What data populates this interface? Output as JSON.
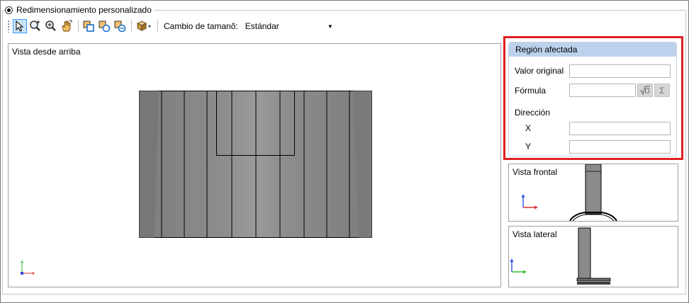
{
  "option": {
    "label": "Redimensionamiento personalizado",
    "selected": true
  },
  "toolbar": {
    "tools": [
      {
        "name": "select-pointer-icon",
        "active": true
      },
      {
        "name": "zoom-window-icon",
        "active": false
      },
      {
        "name": "zoom-icon",
        "active": false
      },
      {
        "name": "pan-hand-icon",
        "active": false
      },
      {
        "name": "region-select-icon",
        "active": false
      },
      {
        "name": "region-add-icon",
        "active": false
      },
      {
        "name": "region-subtract-icon",
        "active": false
      },
      {
        "name": "view-cube-icon",
        "active": false
      }
    ],
    "resize_label": "Cambio de tamanõ:",
    "resize_value": "Estándar"
  },
  "views": {
    "top": "Vista desde arriba",
    "front": "Vista frontal",
    "side": "Vista lateral"
  },
  "region": {
    "title": "Región afectada",
    "original_value_label": "Valor original",
    "original_value": "",
    "formula_label": "Fórmula",
    "formula_value": "",
    "formula_button_icon": "sqrt-formula-icon",
    "sum_button_icon": "sigma-icon",
    "direction_label": "Dirección",
    "x_label": "X",
    "x_value": "",
    "y_label": "Y",
    "y_value": ""
  },
  "colors": {
    "highlight_border": "#e02020",
    "region_header": "#bcd2ec",
    "toolbar_active": "#cce4f7",
    "axis_x": "#e03030",
    "axis_y": "#30c030",
    "axis_z": "#3050e0"
  }
}
